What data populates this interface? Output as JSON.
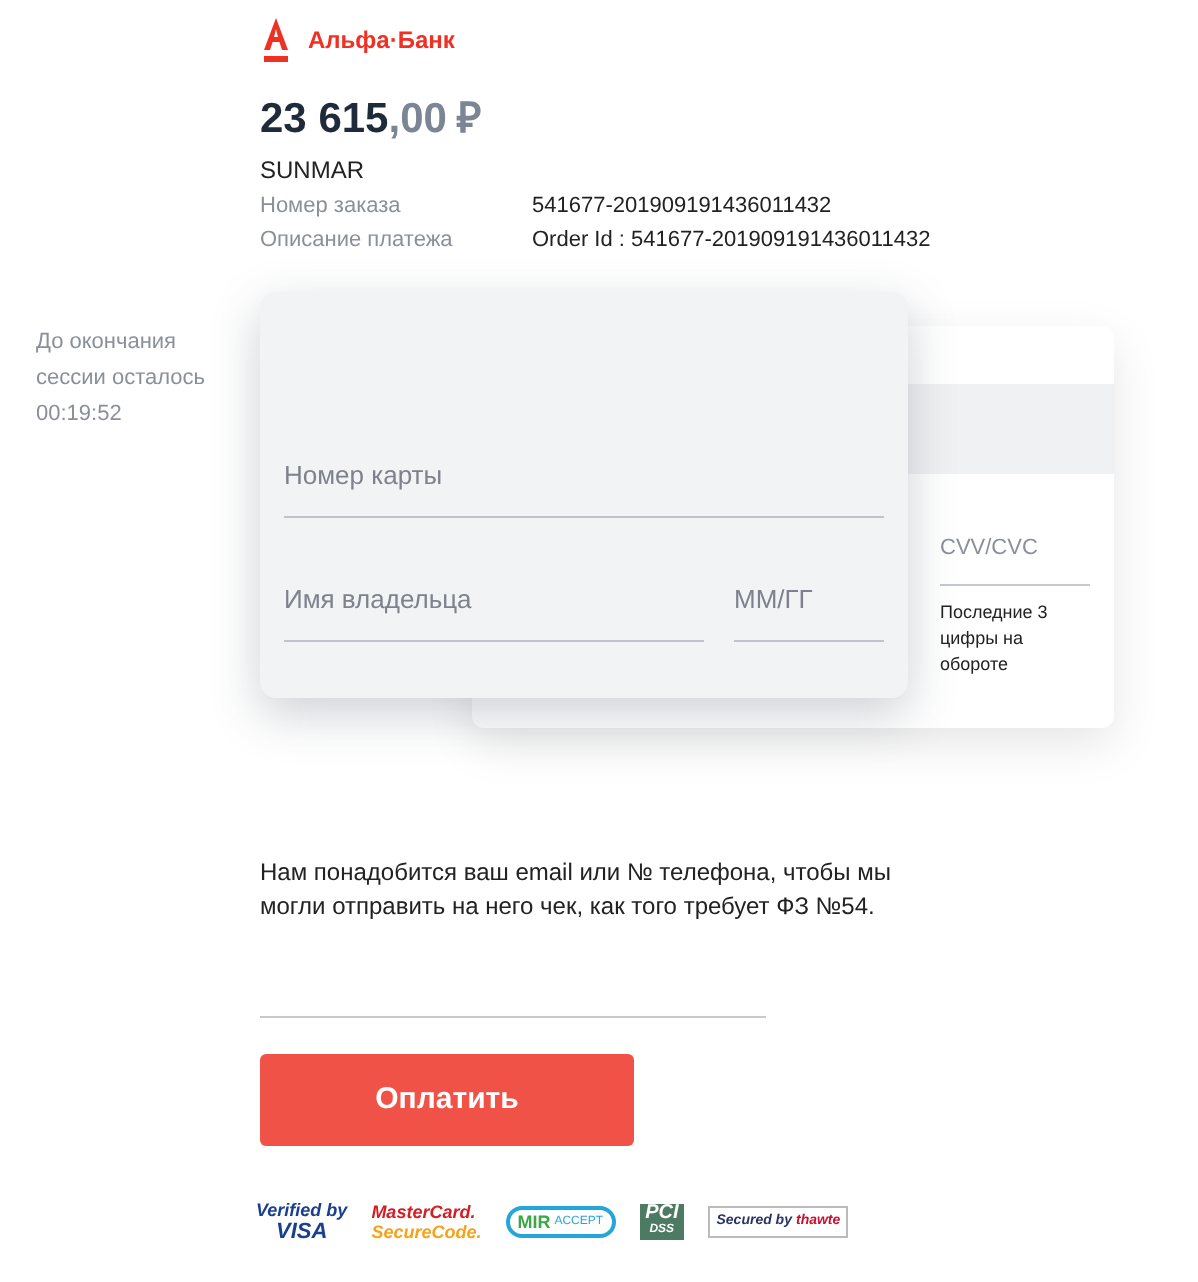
{
  "bank": {
    "name": "Альфа·Банк"
  },
  "amount": {
    "whole": "23 615",
    "fraction": ",00",
    "currency": "₽"
  },
  "merchant": "SUNMAR",
  "details": [
    {
      "label": "Номер заказа",
      "value": "541677-201909191436011432"
    },
    {
      "label": "Описание платежа",
      "value": "Order Id : 541677-201909191436011432"
    }
  ],
  "session": {
    "label": "До окончания сессии осталось",
    "time": "00:19:52"
  },
  "card_front": {
    "number_placeholder": "Номер карты",
    "holder_placeholder": "Имя владельца",
    "expiry_placeholder": "ММ/ГГ"
  },
  "card_back": {
    "cvv_placeholder": "CVV/CVC",
    "hint": "Последние 3 цифры на обороте"
  },
  "receipt_note": "Нам понадобится ваш email или № телефона, чтобы мы могли отправить на него чек, как того требует ФЗ №54.",
  "pay_button": "Оплатить",
  "badges": [
    {
      "kind": "visa",
      "lines": [
        "Verified by",
        "VISA"
      ]
    },
    {
      "kind": "mastercard",
      "lines": [
        "MasterCard.",
        "SecureCode."
      ]
    },
    {
      "kind": "mir",
      "lines": [
        "MIR",
        "ACCEPT"
      ]
    },
    {
      "kind": "pci",
      "lines": [
        "PCI",
        "DSS"
      ]
    },
    {
      "kind": "thawte",
      "lines": [
        "Secured by",
        "thawte"
      ]
    }
  ]
}
